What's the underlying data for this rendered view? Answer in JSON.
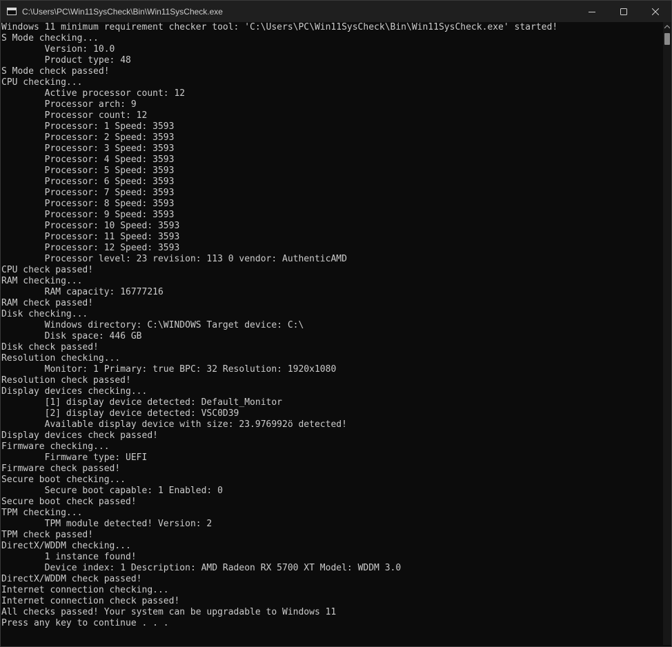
{
  "window": {
    "title": "C:\\Users\\PC\\Win11SysCheck\\Bin\\Win11SysCheck.exe",
    "icons": {
      "app": "console-app-icon",
      "minimize": "minimize-icon",
      "maximize": "maximize-icon",
      "close": "close-icon",
      "scroll_up": "chevron-up-icon"
    }
  },
  "console": {
    "lines": [
      "Windows 11 minimum requirement checker tool: 'C:\\Users\\PC\\Win11SysCheck\\Bin\\Win11SysCheck.exe' started!",
      "S Mode checking...",
      "\tVersion: 10.0",
      "\tProduct type: 48",
      "S Mode check passed!",
      "CPU checking...",
      "\tActive processor count: 12",
      "\tProcessor arch: 9",
      "\tProcessor count: 12",
      "\tProcessor: 1 Speed: 3593",
      "\tProcessor: 2 Speed: 3593",
      "\tProcessor: 3 Speed: 3593",
      "\tProcessor: 4 Speed: 3593",
      "\tProcessor: 5 Speed: 3593",
      "\tProcessor: 6 Speed: 3593",
      "\tProcessor: 7 Speed: 3593",
      "\tProcessor: 8 Speed: 3593",
      "\tProcessor: 9 Speed: 3593",
      "\tProcessor: 10 Speed: 3593",
      "\tProcessor: 11 Speed: 3593",
      "\tProcessor: 12 Speed: 3593",
      "\tProcessor level: 23 revision: 113 0 vendor: AuthenticAMD",
      "CPU check passed!",
      "RAM checking...",
      "\tRAM capacity: 16777216",
      "RAM check passed!",
      "Disk checking...",
      "\tWindows directory: C:\\WINDOWS Target device: C:\\",
      "\tDisk space: 446 GB",
      "Disk check passed!",
      "Resolution checking...",
      "\tMonitor: 1 Primary: true BPC: 32 Resolution: 1920x1080",
      "Resolution check passed!",
      "Display devices checking...",
      "\t[1] display device detected: Default_Monitor",
      "\t[2] display device detected: VSC0D39",
      "\tAvailable display device with size: 23.976992ö detected!",
      "Display devices check passed!",
      "Firmware checking...",
      "\tFirmware type: UEFI",
      "Firmware check passed!",
      "Secure boot checking...",
      "\tSecure boot capable: 1 Enabled: 0",
      "Secure boot check passed!",
      "TPM checking...",
      "\tTPM module detected! Version: 2",
      "TPM check passed!",
      "DirectX/WDDM checking...",
      "\t1 instance found!",
      "\tDevice index: 1 Description: AMD Radeon RX 5700 XT Model: WDDM 3.0",
      "DirectX/WDDM check passed!",
      "Internet connection checking...",
      "Internet connection check passed!",
      "All checks passed! Your system can be upgradable to Windows 11",
      "Press any key to continue . . ."
    ]
  }
}
